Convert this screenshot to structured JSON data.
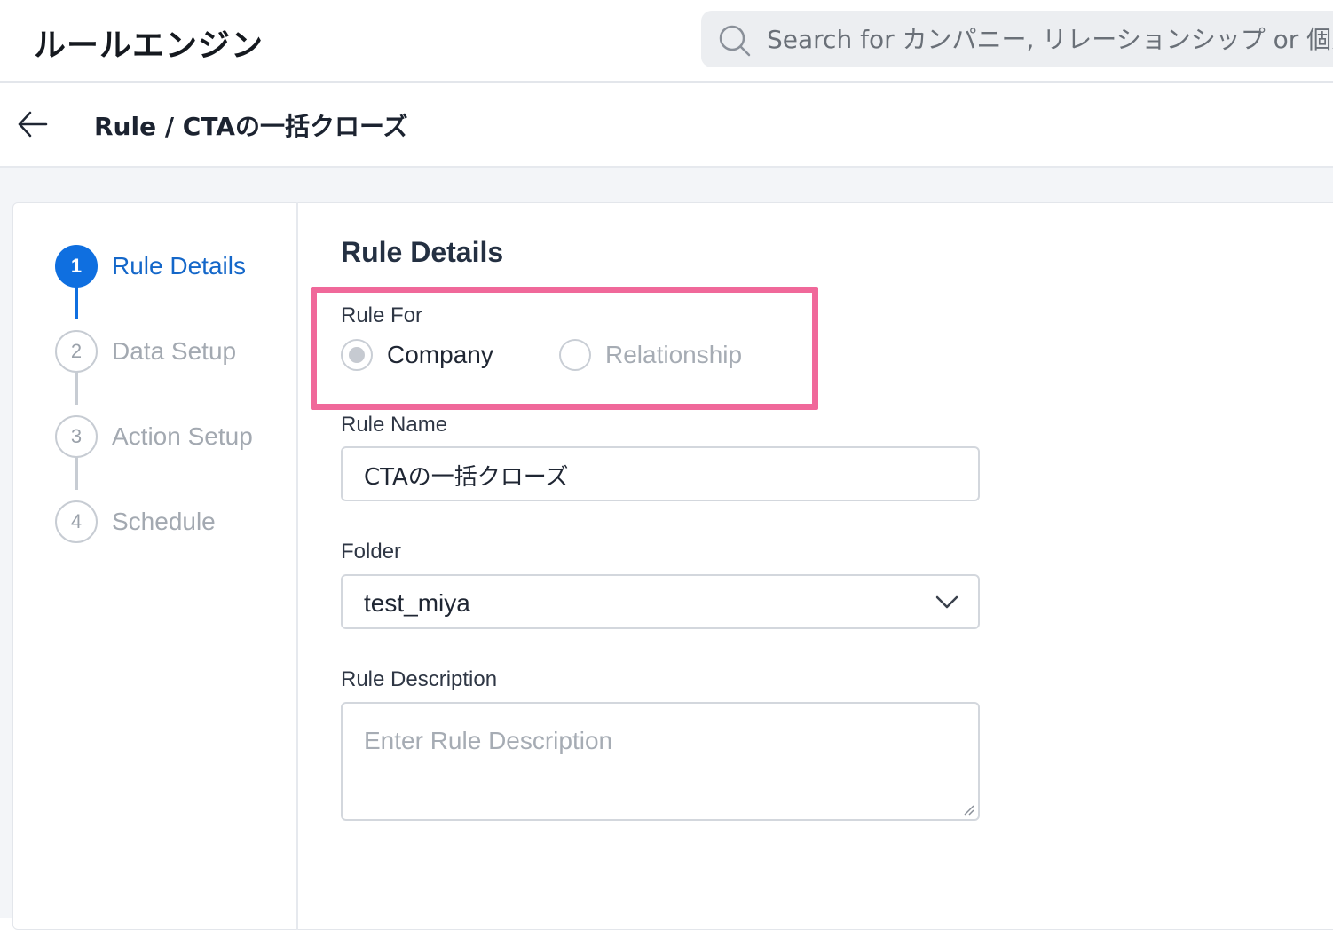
{
  "header": {
    "app_title": "ルールエンジン",
    "search_placeholder": "Search for カンパニー, リレーションシップ or 個人"
  },
  "subheader": {
    "breadcrumb": "Rule / CTAの一括クローズ"
  },
  "stepper": {
    "steps": [
      {
        "number": "1",
        "label": "Rule Details",
        "active": true
      },
      {
        "number": "2",
        "label": "Data Setup",
        "active": false
      },
      {
        "number": "3",
        "label": "Action Setup",
        "active": false
      },
      {
        "number": "4",
        "label": "Schedule",
        "active": false
      }
    ]
  },
  "form": {
    "section_title": "Rule Details",
    "rule_for": {
      "label": "Rule For",
      "options": [
        {
          "label": "Company",
          "selected": true
        },
        {
          "label": "Relationship",
          "selected": false
        }
      ]
    },
    "rule_name": {
      "label": "Rule Name",
      "value": "CTAの一括クローズ"
    },
    "folder": {
      "label": "Folder",
      "value": "test_miya"
    },
    "rule_description": {
      "label": "Rule Description",
      "placeholder": "Enter Rule Description"
    }
  },
  "colors": {
    "accent": "#0f6fe0",
    "highlight": "#f0689a"
  }
}
